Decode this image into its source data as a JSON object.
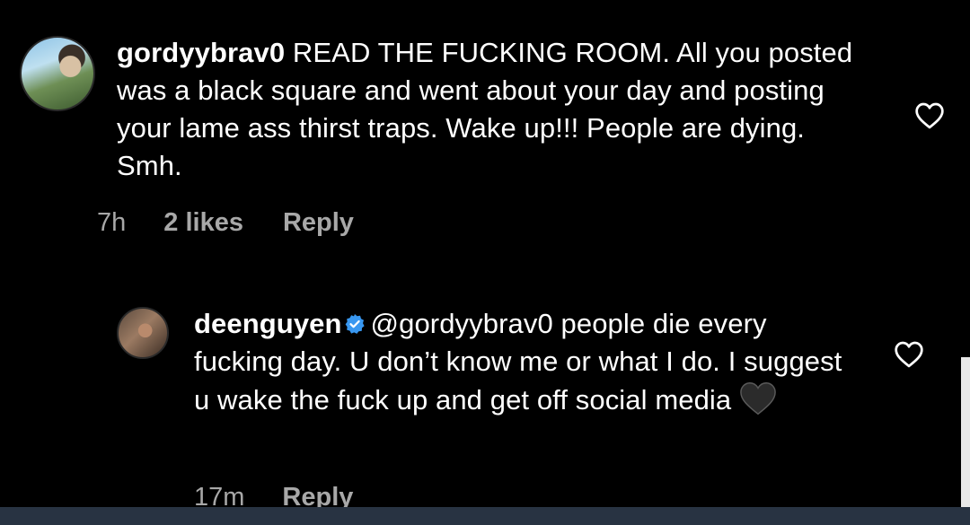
{
  "comment_1": {
    "username": "gordyybrav0",
    "text": " READ THE FUCKING ROOM. All you posted was a black square and went about your day and posting your lame ass thirst traps. Wake up!!! People are dying. Smh.",
    "time": "7h",
    "likes": "2 likes",
    "reply_label": "Reply",
    "like_icon": "heart-outline-icon"
  },
  "comment_2": {
    "username": "deenguyen",
    "verified_icon": "verified-badge-icon",
    "mention": "@gordyybrav0",
    "text": " people die every fucking day. U don’t know me or what I do. I suggest u wake the fuck up and get off social media",
    "emoji": "black-heart-emoji",
    "time": "17m",
    "reply_label": "Reply",
    "like_icon": "heart-outline-icon"
  },
  "colors": {
    "background": "#000000",
    "text": "#ffffff",
    "meta": "#a8a8a8",
    "verified": "#3897f0",
    "bottom_bar": "#283342"
  }
}
